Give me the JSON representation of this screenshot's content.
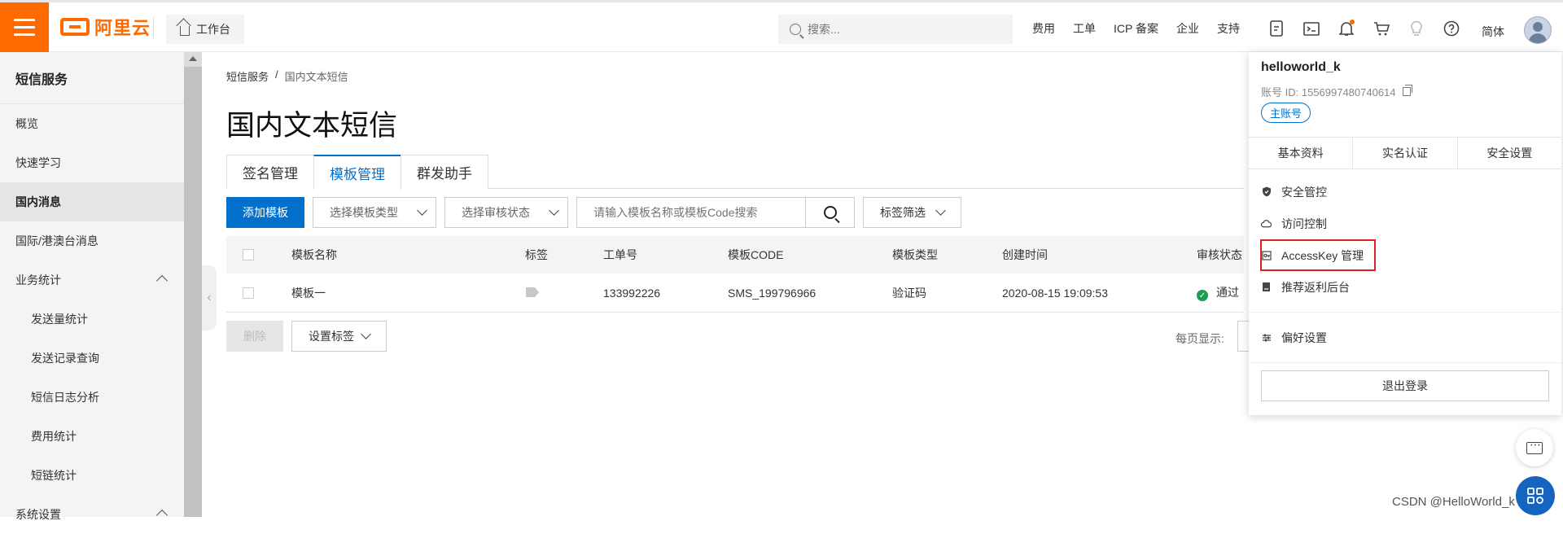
{
  "topbar": {
    "logo_text": "阿里云",
    "workbench_label": "工作台",
    "search_placeholder": "搜索...",
    "nav": [
      "费用",
      "工单",
      "ICP 备案",
      "企业",
      "支持"
    ],
    "icons": [
      "app-icon",
      "terminal-icon",
      "bell-icon",
      "cart-icon",
      "bulb-icon",
      "help-icon"
    ],
    "lang": "简体",
    "accent": "#ff6a00"
  },
  "sidebar": {
    "title": "短信服务",
    "items": [
      {
        "label": "概览",
        "level": 1
      },
      {
        "label": "快速学习",
        "level": 1
      },
      {
        "label": "国内消息",
        "level": 1,
        "active": true
      },
      {
        "label": "国际/港澳台消息",
        "level": 1
      },
      {
        "label": "业务统计",
        "level": 1,
        "expandable": true
      },
      {
        "label": "发送量统计",
        "level": 2
      },
      {
        "label": "发送记录查询",
        "level": 2
      },
      {
        "label": "短信日志分析",
        "level": 2
      },
      {
        "label": "费用统计",
        "level": 2
      },
      {
        "label": "短链统计",
        "level": 2
      },
      {
        "label": "系统设置",
        "level": 1,
        "expandable": true
      }
    ]
  },
  "breadcrumb": {
    "root": "短信服务",
    "sep": "/",
    "current": "国内文本短信"
  },
  "page_title": "国内文本短信",
  "tabs": [
    "签名管理",
    "模板管理",
    "群发助手"
  ],
  "active_tab": "模板管理",
  "toolbar": {
    "add_label": "添加模板",
    "type_select": "选择模板类型",
    "status_select": "选择审核状态",
    "search_placeholder": "请输入模板名称或模板Code搜索",
    "tag_filter": "标签筛选"
  },
  "table": {
    "headers": [
      "模板名称",
      "标签",
      "工单号",
      "模板CODE",
      "模板类型",
      "创建时间",
      "审核状态"
    ],
    "rows": [
      {
        "name": "模板一",
        "ticket": "133992226",
        "code": "SMS_199796966",
        "type": "验证码",
        "created": "2020-08-15 19:09:53",
        "status": "通过"
      }
    ]
  },
  "bottom": {
    "delete_label": "删除",
    "set_tag_label": "设置标签",
    "per_page_label": "每页显示:"
  },
  "account_menu": {
    "username": "helloworld_k",
    "account_id": "账号 ID: 1556997480740614",
    "badge": "主账号",
    "tabs": [
      "基本资料",
      "实名认证",
      "安全设置"
    ],
    "items": [
      {
        "label": "安全管控",
        "icon": "shield-icon"
      },
      {
        "label": "访问控制",
        "icon": "cloud-icon"
      },
      {
        "label": "AccessKey 管理",
        "icon": "key-icon",
        "highlighted": true
      },
      {
        "label": "推荐返利后台",
        "icon": "book-icon"
      }
    ],
    "prefs": {
      "label": "偏好设置",
      "icon": "sliders-icon"
    },
    "logout": "退出登录"
  },
  "watermark": "CSDN @HelloWorld_k"
}
